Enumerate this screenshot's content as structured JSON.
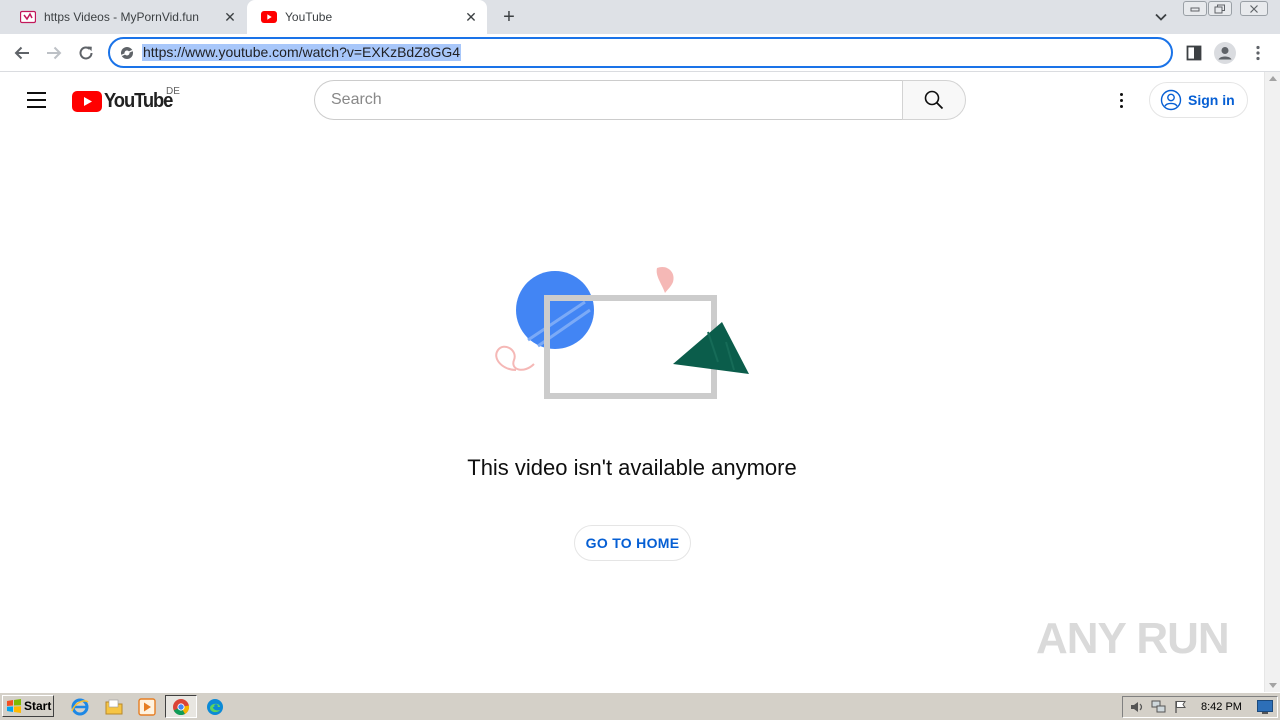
{
  "browser": {
    "tabs": [
      {
        "title": "https Videos - MyPornVid.fun",
        "favicon": "site-favicon",
        "active": false
      },
      {
        "title": "YouTube",
        "favicon": "youtube-favicon",
        "active": true
      }
    ],
    "new_tab_symbol": "+",
    "close_symbol": "✕",
    "address_bar": {
      "url": "https://www.youtube.com/watch?v=EXKzBdZ8GG4",
      "selected": true
    }
  },
  "masthead": {
    "logo_text": "YouTube",
    "country_code": "DE",
    "search": {
      "placeholder": "Search"
    },
    "sign_in_label": "Sign in"
  },
  "error": {
    "message": "This video isn't available anymore",
    "button_label": "GO TO HOME"
  },
  "watermark": {
    "text": "ANY RUN"
  },
  "taskbar": {
    "start_label": "Start",
    "clock": "8:42 PM",
    "quick_launch": [
      "internet-explorer-icon",
      "folder-icon",
      "media-player-icon",
      "chrome-icon",
      "edge-icon"
    ]
  },
  "colors": {
    "youtube_red": "#ff0000",
    "link_blue": "#065fd4",
    "chrome_accent": "#1a73e8",
    "illustration_blue": "#4285f4",
    "illustration_green": "#0b5d4b",
    "illustration_pink": "#f5b8b6"
  }
}
